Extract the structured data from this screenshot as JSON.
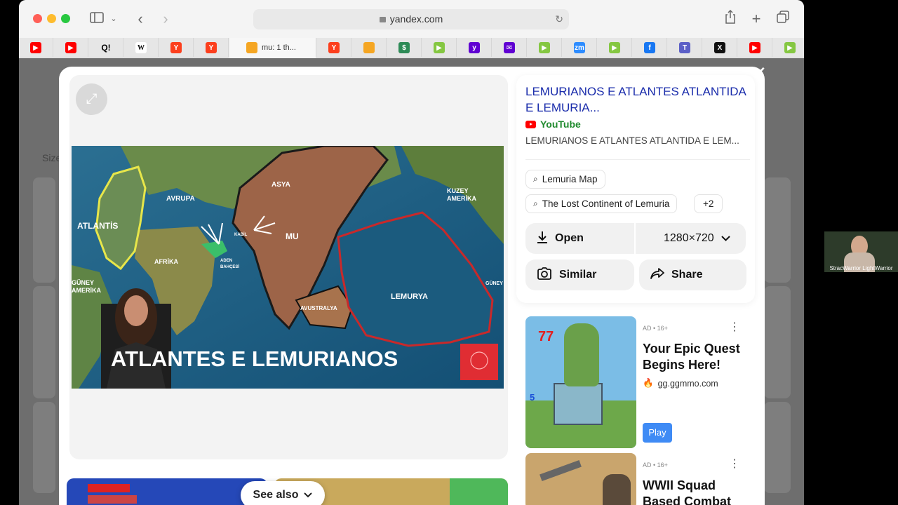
{
  "browser": {
    "url": "yandex.com",
    "active_tab_label": "mu: 1 th...",
    "tabs": [
      {
        "icon": "youtube-icon",
        "color": "#ff0000",
        "glyph": "▶"
      },
      {
        "icon": "youtube-icon",
        "color": "#ff0000",
        "glyph": "▶"
      },
      {
        "icon": "q-icon",
        "color": "#000000",
        "glyph": "Q!"
      },
      {
        "icon": "wikipedia-icon",
        "color": "#ffffff",
        "glyph": "W"
      },
      {
        "icon": "yandex-icon",
        "color": "#fc3f1d",
        "glyph": "Y"
      },
      {
        "icon": "yandex-icon",
        "color": "#fc3f1d",
        "glyph": "Y"
      },
      {
        "icon": "image-icon",
        "color": "#f5a623",
        "glyph": ""
      },
      {
        "icon": "yandex-icon",
        "color": "#fc3f1d",
        "glyph": "Y"
      },
      {
        "icon": "image-icon",
        "color": "#f5a623",
        "glyph": ""
      },
      {
        "icon": "dollar-icon",
        "color": "#2e8b57",
        "glyph": "$"
      },
      {
        "icon": "rumble-icon",
        "color": "#85c742",
        "glyph": "▶"
      },
      {
        "icon": "yahoo-icon",
        "color": "#6001d2",
        "glyph": "y"
      },
      {
        "icon": "mail-icon",
        "color": "#6001d2",
        "glyph": "✉"
      },
      {
        "icon": "rumble-icon",
        "color": "#85c742",
        "glyph": "▶"
      },
      {
        "icon": "zoom-icon",
        "color": "#2d8cff",
        "glyph": "zm"
      },
      {
        "icon": "rumble-icon",
        "color": "#85c742",
        "glyph": "▶"
      },
      {
        "icon": "facebook-icon",
        "color": "#1877f2",
        "glyph": "f"
      },
      {
        "icon": "teams-icon",
        "color": "#5b5fc7",
        "glyph": "T"
      },
      {
        "icon": "x-icon",
        "color": "#111111",
        "glyph": "X"
      },
      {
        "icon": "youtube-icon",
        "color": "#ff0000",
        "glyph": "▶"
      },
      {
        "icon": "rumble-icon",
        "color": "#85c742",
        "glyph": "▶"
      }
    ]
  },
  "page": {
    "size_label": "Size"
  },
  "viewer": {
    "image_caption": "ATLANTES E LEMURIANOS",
    "map_labels": {
      "atlantis": "ATLANTİS",
      "avrupa": "AVRUPA",
      "asya": "ASYA",
      "mu": "MU",
      "afrika": "AFRİKA",
      "kuzey_amerika_1": "KUZEY",
      "kuzey_amerika_2": "AMERİKA",
      "guney_amerika_1": "GÜNEY",
      "guney_amerika_2": "AMERİKA",
      "lemurya": "LEMURYA",
      "avustralya": "AVUSTRALYA",
      "aden": "ADEN",
      "bahcesi": "BAHÇESİ",
      "kabil": "KABİL",
      "guney_right": "GÜNEY"
    },
    "see_also_label": "See also"
  },
  "info": {
    "title": "LEMURIANOS E ATLANTES ATLANTIDA E LEMURIA...",
    "source": "YouTube",
    "description": "LEMURIANOS E ATLANTES ATLANTIDA E LEM...",
    "chips": [
      "Lemuria Map",
      "The Lost Continent of Lemuria",
      "+2"
    ],
    "open_label": "Open",
    "resolution": "1280×720",
    "similar_label": "Similar",
    "share_label": "Share"
  },
  "ads": [
    {
      "tag": "AD • 16+",
      "title": "Your Epic Quest Begins Here!",
      "domain": "gg.ggmmo.com",
      "button": "Play",
      "badge_top": "77",
      "badge_side": "5"
    },
    {
      "tag": "AD • 16+",
      "title": "WWII Squad Based Combat",
      "domain": "",
      "button": ""
    }
  ],
  "webcam": {
    "label": "StracWarrior LightWarrior"
  }
}
